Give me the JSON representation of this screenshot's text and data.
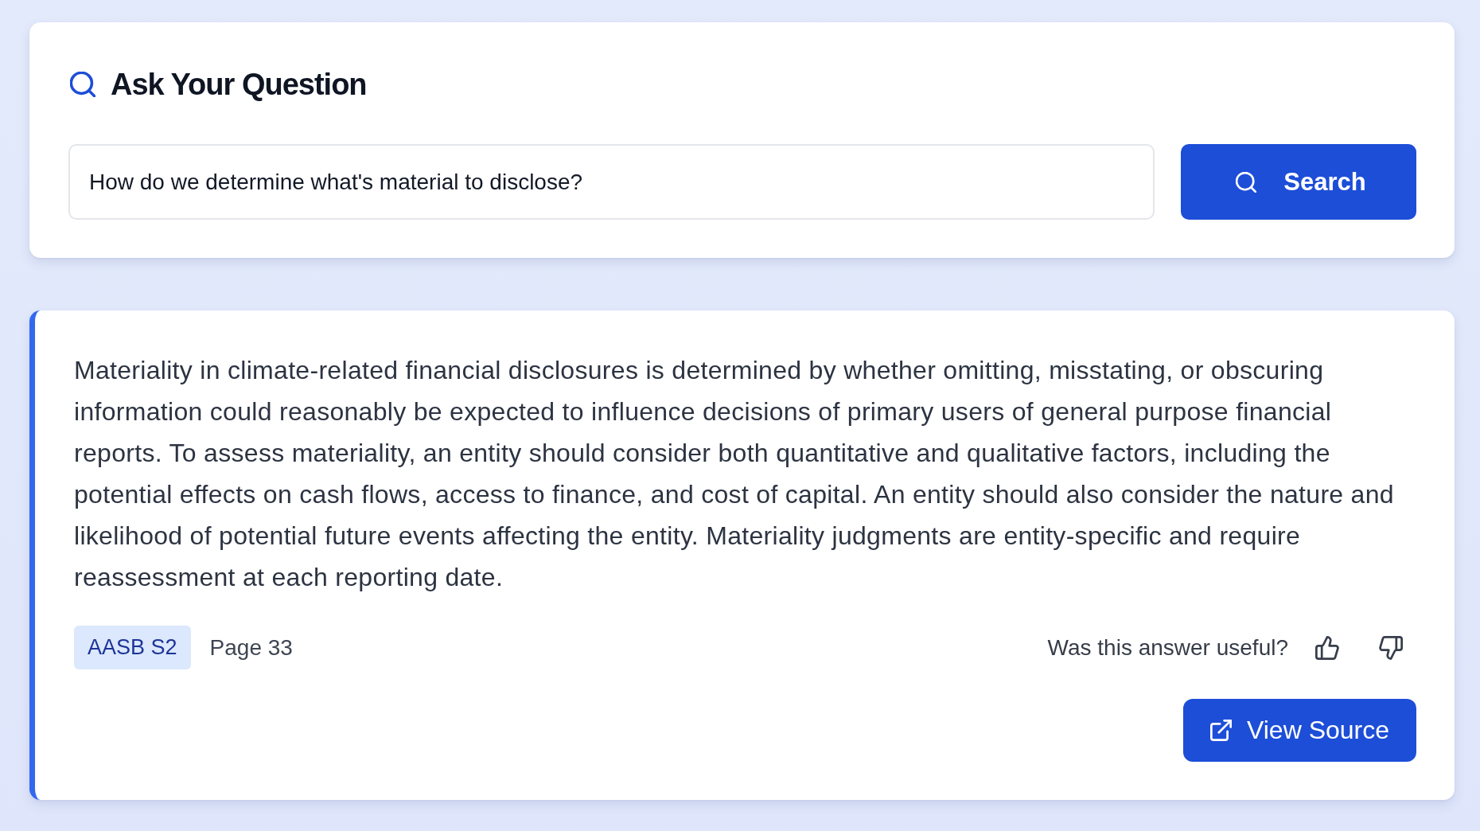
{
  "question_panel": {
    "title": "Ask Your Question",
    "query_field": {
      "value": "How do we determine what's material to disclose?"
    },
    "search_button": "Search"
  },
  "answer_card": {
    "text": "Materiality in climate-related financial disclosures is determined by whether omitting, misstating, or obscuring information could reasonably be expected to influence decisions of primary users of general purpose financial reports. To assess materiality, an entity should consider both quantitative and qualitative factors, including the potential effects on cash flows, access to finance, and cost of capital. An entity should also consider the nature and likelihood of potential future events affecting the entity. Materiality judgments are entity-specific and require reassessment at each reporting date.",
    "source_tag": "AASB S2",
    "page": "Page 33",
    "feedback": {
      "prompt": "Was this answer useful?"
    },
    "view_source_button": "View Source"
  }
}
